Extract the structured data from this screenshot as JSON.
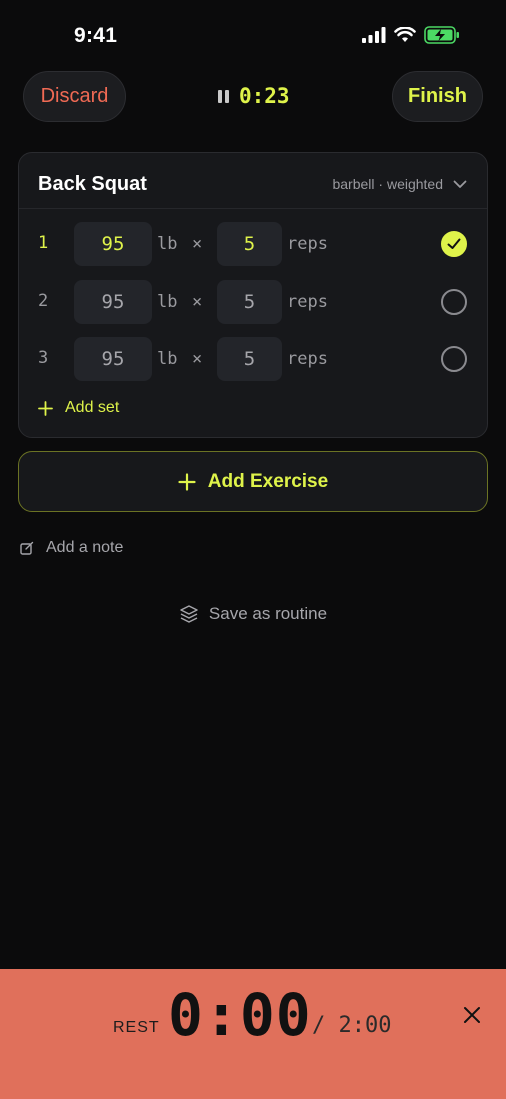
{
  "status": {
    "time": "9:41"
  },
  "top": {
    "discard_label": "Discard",
    "timer": "0:23",
    "finish_label": "Finish"
  },
  "exercise": {
    "name": "Back Squat",
    "meta": "barbell · weighted",
    "sets": [
      {
        "num": "1",
        "weight": "95",
        "unit": "lb",
        "x": "×",
        "reps": "5",
        "reps_label": "reps",
        "done": true
      },
      {
        "num": "2",
        "weight": "95",
        "unit": "lb",
        "x": "×",
        "reps": "5",
        "reps_label": "reps",
        "done": false
      },
      {
        "num": "3",
        "weight": "95",
        "unit": "lb",
        "x": "×",
        "reps": "5",
        "reps_label": "reps",
        "done": false
      }
    ],
    "add_set_label": "Add set"
  },
  "add_exercise_label": "Add Exercise",
  "note_label": "Add a note",
  "save_routine_label": "Save as routine",
  "rest": {
    "label": "REST",
    "remaining": "0:00",
    "total": "/ 2:00"
  },
  "colors": {
    "accent": "#dff34a",
    "danger": "#f06a54",
    "rest_bg": "#e0705b"
  }
}
